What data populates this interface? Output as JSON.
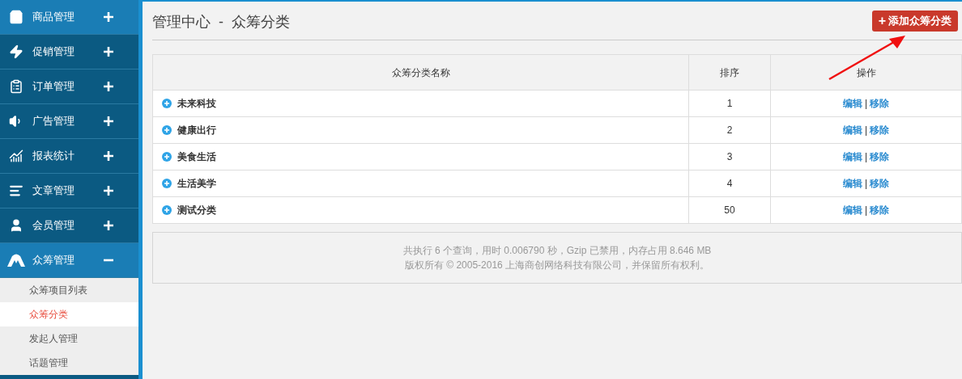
{
  "sidebar": {
    "items": [
      {
        "label": "商品管理",
        "highlighted": true,
        "expanded": false
      },
      {
        "label": "促销管理",
        "highlighted": false,
        "expanded": false
      },
      {
        "label": "订单管理",
        "highlighted": false,
        "expanded": false
      },
      {
        "label": "广告管理",
        "highlighted": false,
        "expanded": false
      },
      {
        "label": "报表统计",
        "highlighted": false,
        "expanded": false
      },
      {
        "label": "文章管理",
        "highlighted": false,
        "expanded": false
      },
      {
        "label": "会员管理",
        "highlighted": false,
        "expanded": false
      },
      {
        "label": "众筹管理",
        "highlighted": true,
        "expanded": true,
        "children": [
          {
            "label": "众筹项目列表",
            "selected": false
          },
          {
            "label": "众筹分类",
            "selected": true
          },
          {
            "label": "发起人管理",
            "selected": false
          },
          {
            "label": "话题管理",
            "selected": false
          }
        ]
      }
    ]
  },
  "header": {
    "title": "管理中心",
    "separator": "-",
    "subtitle": "众筹分类",
    "add_button": "添加众筹分类",
    "add_icon": "+"
  },
  "table": {
    "columns": [
      "众筹分类名称",
      "排序",
      "操作"
    ],
    "rows": [
      {
        "name": "未来科技",
        "sort": "1",
        "edit": "编辑",
        "divider": "|",
        "remove": "移除"
      },
      {
        "name": "健康出行",
        "sort": "2",
        "edit": "编辑",
        "divider": "|",
        "remove": "移除"
      },
      {
        "name": "美食生活",
        "sort": "3",
        "edit": "编辑",
        "divider": "|",
        "remove": "移除"
      },
      {
        "name": "生活美学",
        "sort": "4",
        "edit": "编辑",
        "divider": "|",
        "remove": "移除"
      },
      {
        "name": "测试分类",
        "sort": "50",
        "edit": "编辑",
        "divider": "|",
        "remove": "移除"
      }
    ]
  },
  "footer": {
    "lines": [
      "共执行 6 个查询，用时 0.006790 秒，Gzip 已禁用，内存占用 8.646 MB",
      "版权所有 © 2005-2016 上海商创网络科技有限公司，并保留所有权利。"
    ]
  }
}
